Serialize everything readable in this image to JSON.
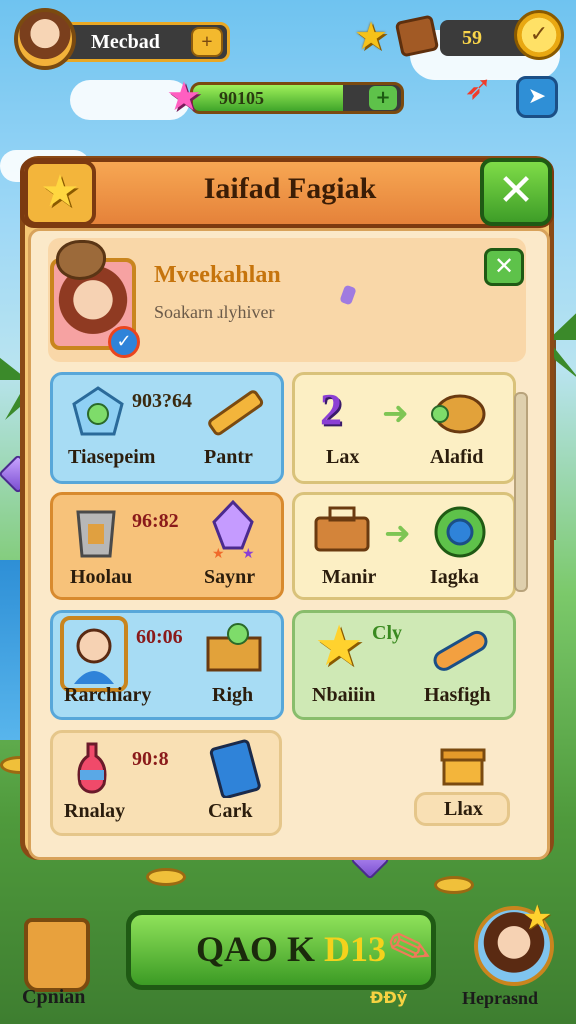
{
  "hud": {
    "player_name": "Mecbad",
    "coins": "59",
    "coin_icon_glyph": "✓",
    "plus_glyph": "+",
    "xp_value": "90105",
    "xp_fraction": 0.72
  },
  "panel": {
    "title": "Iaifad Fagiak",
    "close_glyph": "✕",
    "star_glyph": "★"
  },
  "profile": {
    "name": "Mveekahlan",
    "subtitle": "Soakarn ɹlyhiver",
    "close_glyph": "✕"
  },
  "tiles": {
    "t1": {
      "number": "903?64",
      "left_label": "Tiasepeim",
      "right_label": "Pantr"
    },
    "t2": {
      "number": "2",
      "left_label": "Lax",
      "right_label": "Alafid"
    },
    "t3": {
      "number": "96:82",
      "left_label": "Hoolau",
      "right_label": "Saynr"
    },
    "t4": {
      "left_label": "Manir",
      "right_label": "Iagka"
    },
    "t5": {
      "number": "60:06",
      "left_label": "Rarchiary",
      "right_label": "Righ"
    },
    "t6": {
      "number": "Cly",
      "left_label": "Nbaiiin",
      "right_label": "Hasfigh"
    },
    "t7": {
      "number": "90:8",
      "left_label": "Rnalay",
      "right_label": "Cark"
    },
    "t8": {
      "right_label": "Llax"
    }
  },
  "bottom": {
    "cta_part1": "QAO K ",
    "cta_part2": "D13",
    "cta_sub": "ĐĐŷ",
    "left_label": "Cpnian",
    "right_label": "Heprasnd"
  },
  "colors": {
    "accent_green": "#3fa52a",
    "accent_orange": "#e5823a",
    "gold": "#f3b92e"
  }
}
